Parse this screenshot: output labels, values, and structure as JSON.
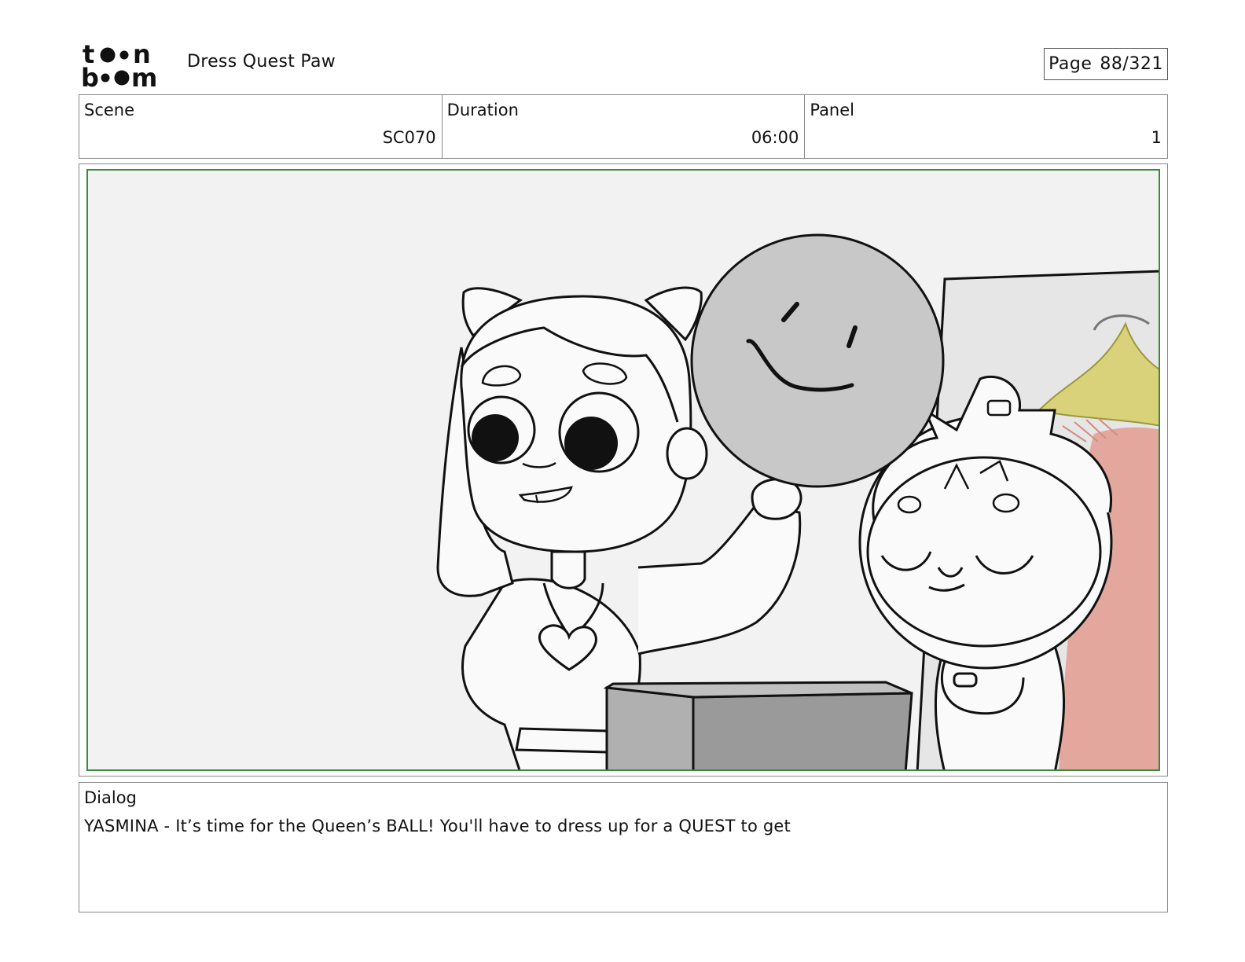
{
  "header": {
    "logo_text": "toon boom",
    "project_title": "Dress Quest Paw",
    "page_label": "Page",
    "page_value": "88/321"
  },
  "info": {
    "scene_label": "Scene",
    "scene_value": "SC070",
    "duration_label": "Duration",
    "duration_value": "06:00",
    "panel_label": "Panel",
    "panel_value": "1"
  },
  "panel_image": {
    "content": "storyboard-sketch",
    "colors": {
      "frame_border": "#3a8a3a",
      "background": "#f2f2f2",
      "balloon": "#c8c8c8",
      "box": "#9a9a9a",
      "curtain": "#e3a79e",
      "tassel": "#d9d27a"
    }
  },
  "dialog": {
    "label": "Dialog",
    "text": "YASMINA - It’s time for the Queen’s BALL! You'll have to dress up for a QUEST to get"
  }
}
